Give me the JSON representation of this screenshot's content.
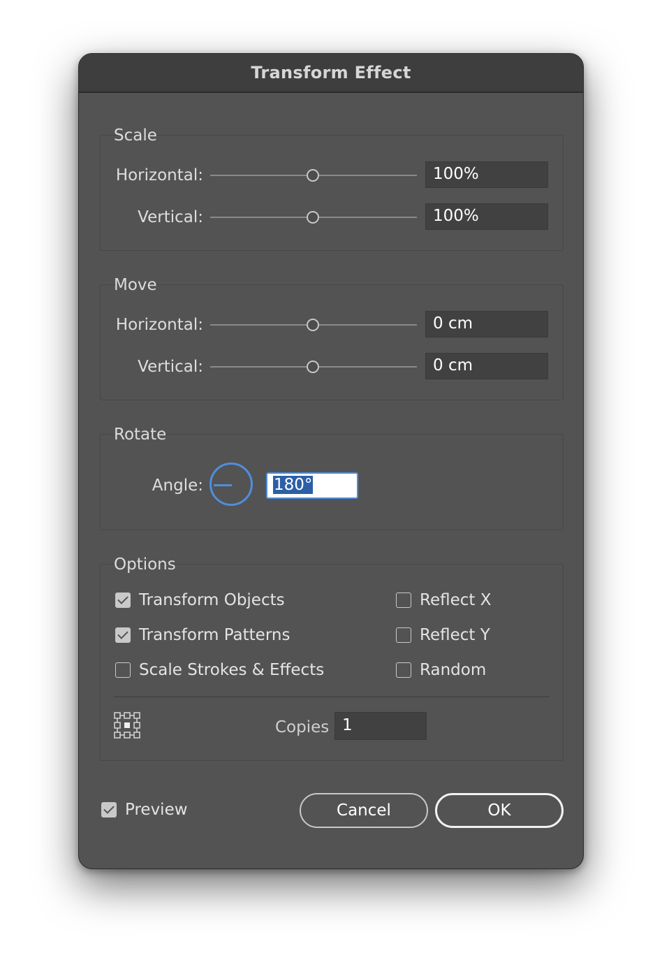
{
  "dialog": {
    "title": "Transform Effect"
  },
  "scale": {
    "legend": "Scale",
    "horizontal_label": "Horizontal:",
    "horizontal_value": "100%",
    "vertical_label": "Vertical:",
    "vertical_value": "100%"
  },
  "move": {
    "legend": "Move",
    "horizontal_label": "Horizontal:",
    "horizontal_value": "0 cm",
    "vertical_label": "Vertical:",
    "vertical_value": "0 cm"
  },
  "rotate": {
    "legend": "Rotate",
    "angle_label": "Angle:",
    "angle_value": "180°"
  },
  "options": {
    "legend": "Options",
    "transform_objects": {
      "label": "Transform Objects",
      "checked": true
    },
    "transform_patterns": {
      "label": "Transform Patterns",
      "checked": true
    },
    "scale_strokes": {
      "label": "Scale Strokes & Effects",
      "checked": false
    },
    "reflect_x": {
      "label": "Reflect X",
      "checked": false
    },
    "reflect_y": {
      "label": "Reflect Y",
      "checked": false
    },
    "random": {
      "label": "Random",
      "checked": false
    },
    "copies_label": "Copies",
    "copies_value": "1"
  },
  "footer": {
    "preview": {
      "label": "Preview",
      "checked": true
    },
    "cancel_label": "Cancel",
    "ok_label": "OK"
  },
  "colors": {
    "dialog_bg": "#535353",
    "titlebar_bg": "#3f3e3e",
    "accent": "#4e8fdc",
    "selection": "#2c5fa8"
  },
  "icons": {
    "reference_point": "reference-point-grid-icon",
    "checkbox_checked": "checkmark-icon"
  }
}
